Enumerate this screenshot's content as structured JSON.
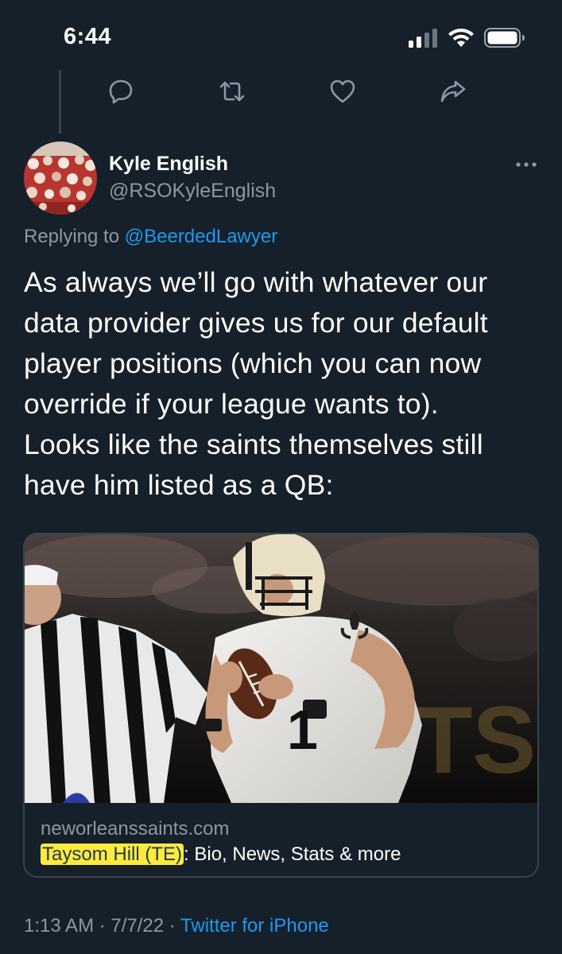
{
  "status_bar": {
    "time": "6:44",
    "icons": [
      "cellular-signal-icon",
      "wifi-icon",
      "battery-icon"
    ]
  },
  "previous_tweet_actions": [
    "reply-icon",
    "retweet-icon",
    "like-icon",
    "share-icon"
  ],
  "tweet": {
    "author": {
      "name": "Kyle English",
      "handle": "@RSOKyleEnglish"
    },
    "replying_prefix": "Replying to ",
    "replying_to": "@BeerdedLawyer",
    "text_lines": [
      "As always we’ll go with whatever our",
      "data provider gives us for our default",
      "player positions (which you can now",
      "override if your league wants to).",
      "Looks like the saints themselves still",
      "have him listed as a QB:"
    ],
    "card": {
      "domain": "neworleanssaints.com",
      "title_highlight": "Taysom Hill (TE)",
      "title_rest": ": Bio, News, Stats & more"
    },
    "meta": {
      "time": "1:13 AM",
      "separator": " · ",
      "date": "7/7/22",
      "source": "Twitter for iPhone"
    }
  },
  "colors": {
    "background": "#15202b",
    "text_primary": "#ffffff",
    "text_secondary": "#8b98a5",
    "link": "#1d9bf0",
    "border": "#38444d",
    "highlight": "#ffea3d"
  }
}
